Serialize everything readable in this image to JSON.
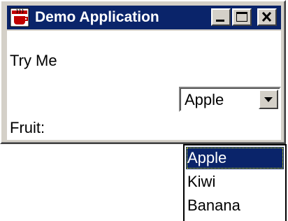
{
  "window": {
    "title": "Demo Application",
    "controls": {
      "minimize_icon": "minimize-icon",
      "maximize_icon": "maximize-icon",
      "close_icon": "close-icon"
    },
    "colors": {
      "titlebar": "#0a246a",
      "face": "#d4d0c8",
      "selection": "#0a246a"
    }
  },
  "content": {
    "try_label": "Try Me",
    "fruit_label": "Fruit:"
  },
  "combo": {
    "value": "Apple",
    "options": [
      "Apple",
      "Kiwi",
      "Banana"
    ],
    "selected_index": 0
  }
}
